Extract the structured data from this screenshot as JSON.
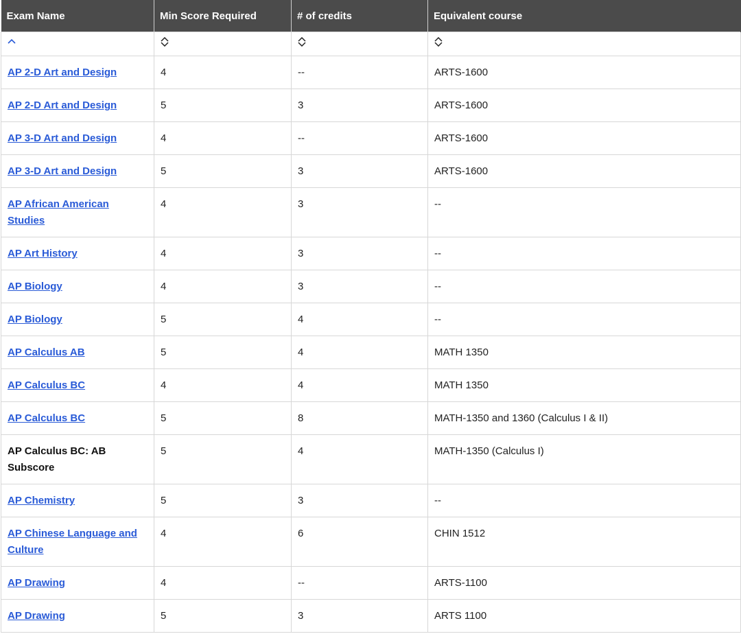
{
  "headers": [
    "Exam Name",
    "Min Score Required",
    "# of credits",
    "Equivalent course"
  ],
  "sort_icons": [
    "chevron-up-icon",
    "sort-diamond-icon",
    "sort-diamond-icon",
    "sort-diamond-icon"
  ],
  "accent_link_color": "#2a5bd7",
  "header_bg_color": "#4b4b4b",
  "rows": [
    {
      "exam": "AP 2-D Art and Design",
      "min": "4",
      "credits": "--",
      "course": "ARTS-1600",
      "link": true
    },
    {
      "exam": "AP 2-D Art and Design",
      "min": "5",
      "credits": "3",
      "course": "ARTS-1600",
      "link": true
    },
    {
      "exam": "AP 3-D Art and Design",
      "min": "4",
      "credits": "--",
      "course": "ARTS-1600",
      "link": true
    },
    {
      "exam": "AP 3-D Art and Design",
      "min": "5",
      "credits": "3",
      "course": "ARTS-1600",
      "link": true
    },
    {
      "exam": "AP African American Studies",
      "min": "4",
      "credits": "3",
      "course": "--",
      "link": true
    },
    {
      "exam": "AP Art History",
      "min": "4",
      "credits": "3",
      "course": "--",
      "link": true
    },
    {
      "exam": "AP Biology",
      "min": "4",
      "credits": "3",
      "course": "--",
      "link": true
    },
    {
      "exam": "AP Biology",
      "min": "5",
      "credits": "4",
      "course": "--",
      "link": true
    },
    {
      "exam": "AP Calculus AB",
      "min": "5",
      "credits": "4",
      "course": "MATH 1350",
      "link": true
    },
    {
      "exam": "AP Calculus BC",
      "min": "4",
      "credits": "4",
      "course": "MATH 1350",
      "link": true
    },
    {
      "exam": "AP Calculus BC",
      "min": "5",
      "credits": "8",
      "course": "MATH-1350 and 1360 (Calculus I & II)",
      "link": true
    },
    {
      "exam": "AP Calculus BC: AB Subscore",
      "min": "5",
      "credits": "4",
      "course": "MATH-1350 (Calculus I)",
      "link": false
    },
    {
      "exam": "AP Chemistry",
      "min": "5",
      "credits": "3",
      "course": "--",
      "link": true
    },
    {
      "exam": "AP Chinese Language and Culture",
      "min": "4",
      "credits": "6",
      "course": "CHIN 1512",
      "link": true
    },
    {
      "exam": "AP Drawing",
      "min": "4",
      "credits": "--",
      "course": "ARTS-1100",
      "link": true
    },
    {
      "exam": "AP Drawing",
      "min": "5",
      "credits": "3",
      "course": "ARTS 1100",
      "link": true
    }
  ]
}
